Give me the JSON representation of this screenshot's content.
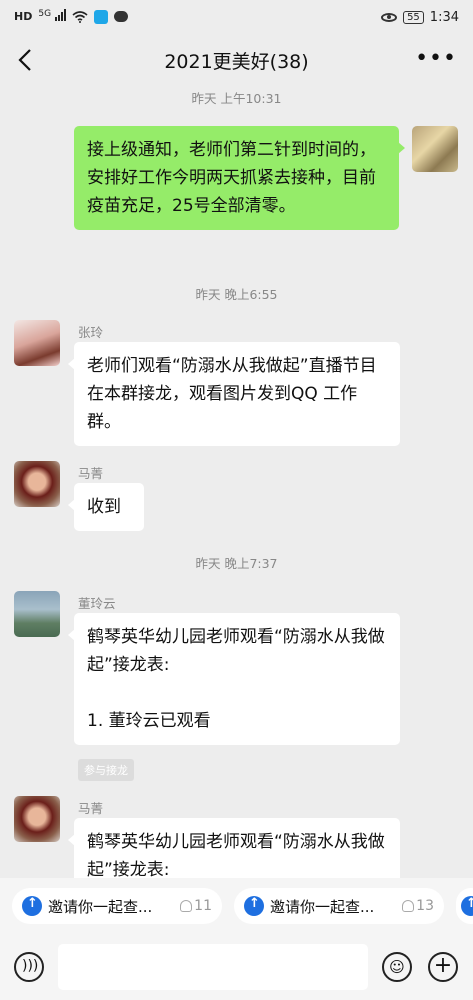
{
  "status_bar": {
    "hd": "HD",
    "network": "5G",
    "battery": "55",
    "time": "1:34"
  },
  "header": {
    "title": "2021更美好(38)"
  },
  "messages": {
    "t1": "昨天 上午10:31",
    "m1": "接上级通知，老师们第二针到时间的，安排好工作今明两天抓紧去接种，目前疫苗充足，25号全部清零。",
    "t2": "昨天 晚上6:55",
    "m2_sender": "张玲",
    "m2": "老师们观看“防溺水从我做起”直播节目在本群接龙，观看图片发到QQ 工作群。",
    "m3_sender": "马菁",
    "m3": "收到",
    "t3": "昨天 晚上7:37",
    "m4_sender": "董玲云",
    "m4": "鹤琴英华幼儿园老师观看“防溺水从我做起”接龙表:\n\n1. 董玲云已观看",
    "m4_tag": "参与接龙",
    "m5_sender": "马菁",
    "m5": "鹤琴英华幼儿园老师观看“防溺水从我做起”接龙表:"
  },
  "chips": [
    {
      "label": "邀请你一起查...",
      "count": "11"
    },
    {
      "label": "邀请你一起查...",
      "count": "13"
    }
  ],
  "colors": {
    "background": "#ededed",
    "self_bubble": "#95ec69",
    "chip_icon": "#1e6fe0"
  }
}
